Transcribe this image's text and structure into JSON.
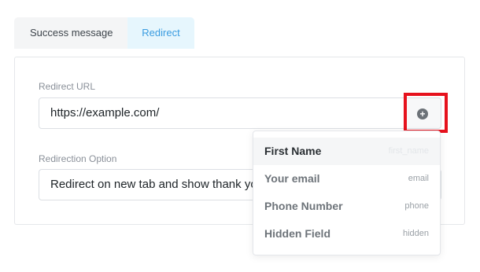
{
  "tabs": [
    {
      "label": "Success message",
      "active": false
    },
    {
      "label": "Redirect",
      "active": true
    }
  ],
  "redirect_url": {
    "label": "Redirect URL",
    "value": "https://example.com/",
    "addon_icon": "plus-circle-icon"
  },
  "redirection_option": {
    "label": "Redirection Option",
    "value": "Redirect on new tab and show thank you"
  },
  "dropdown": {
    "items": [
      {
        "label": "First Name",
        "key": "first_name"
      },
      {
        "label": "Your email",
        "key": "email"
      },
      {
        "label": "Phone Number",
        "key": "phone"
      },
      {
        "label": "Hidden Field",
        "key": "hidden"
      }
    ]
  },
  "colors": {
    "accent": "#3a9ce0",
    "highlight": "#e6121d"
  }
}
